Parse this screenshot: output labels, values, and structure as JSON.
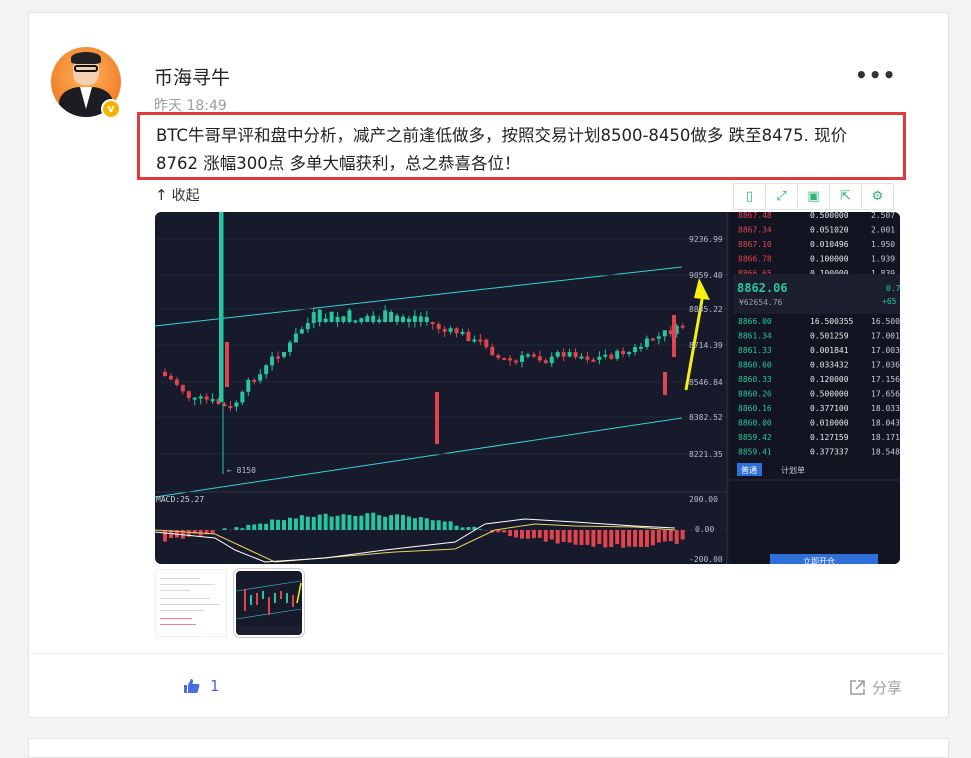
{
  "post": {
    "author": "币海寻牛",
    "time": "昨天 18:49",
    "content": "BTC牛哥早评和盘中分析，减产之前逢低做多，按照交易计划8500-8450做多 跌至8475. 现价8762 涨幅300点 多单大幅获利，总之恭喜各位！",
    "collapse_label": "收起",
    "verified_badge": "v"
  },
  "toolbar": {
    "icons": [
      "copy-icon",
      "fullscreen-icon",
      "save-icon",
      "export-icon",
      "settings-icon"
    ]
  },
  "actions": {
    "like_count": "1",
    "share_label": "分享"
  },
  "chart_panel": {
    "price_ticks": [
      "9236.99",
      "9059.40",
      "8885.22",
      "8714.39",
      "8546.84",
      "8382.52",
      "8221.35"
    ],
    "low_label": "8150",
    "macd_label": "MACD:25.27",
    "macd_ticks": [
      "200.00",
      "0.00",
      "-200.00"
    ],
    "asks": [
      {
        "price": "8867.48",
        "qty": "0.500000",
        "total": "2.507"
      },
      {
        "price": "8867.34",
        "qty": "0.051020",
        "total": "2.001"
      },
      {
        "price": "8867.10",
        "qty": "0.010496",
        "total": "1.950"
      },
      {
        "price": "8866.78",
        "qty": "0.100000",
        "total": "1.939"
      },
      {
        "price": "8866.65",
        "qty": "0.100000",
        "total": "1.839"
      }
    ],
    "last_price": "8862.06",
    "last_cny": "¥62654.76",
    "change_top": "0.7",
    "change_bottom": "+65",
    "bids": [
      {
        "price": "8866.00",
        "qty": "16.500355",
        "total": "16.500"
      },
      {
        "price": "8861.34",
        "qty": "0.501259",
        "total": "17.001"
      },
      {
        "price": "8861.33",
        "qty": "0.001841",
        "total": "17.003"
      },
      {
        "price": "8860.60",
        "qty": "0.033432",
        "total": "17.036"
      },
      {
        "price": "8860.33",
        "qty": "0.120000",
        "total": "17.156"
      },
      {
        "price": "8860.26",
        "qty": "0.500000",
        "total": "17.656"
      },
      {
        "price": "8860.16",
        "qty": "0.377100",
        "total": "18.033"
      },
      {
        "price": "8860.00",
        "qty": "0.010000",
        "total": "18.043"
      },
      {
        "price": "8859.42",
        "qty": "0.127159",
        "total": "18.171"
      },
      {
        "price": "8859.41",
        "qty": "0.377337",
        "total": "18.548"
      }
    ],
    "tab_normal": "普通",
    "tab_plan": "计划单",
    "open_button": "立即开仓"
  },
  "colors": {
    "accent_green": "#2bb673",
    "up": "#26c6a0",
    "down": "#e0444e",
    "highlight_box": "#e03a3a",
    "arrow": "#f5f010"
  }
}
